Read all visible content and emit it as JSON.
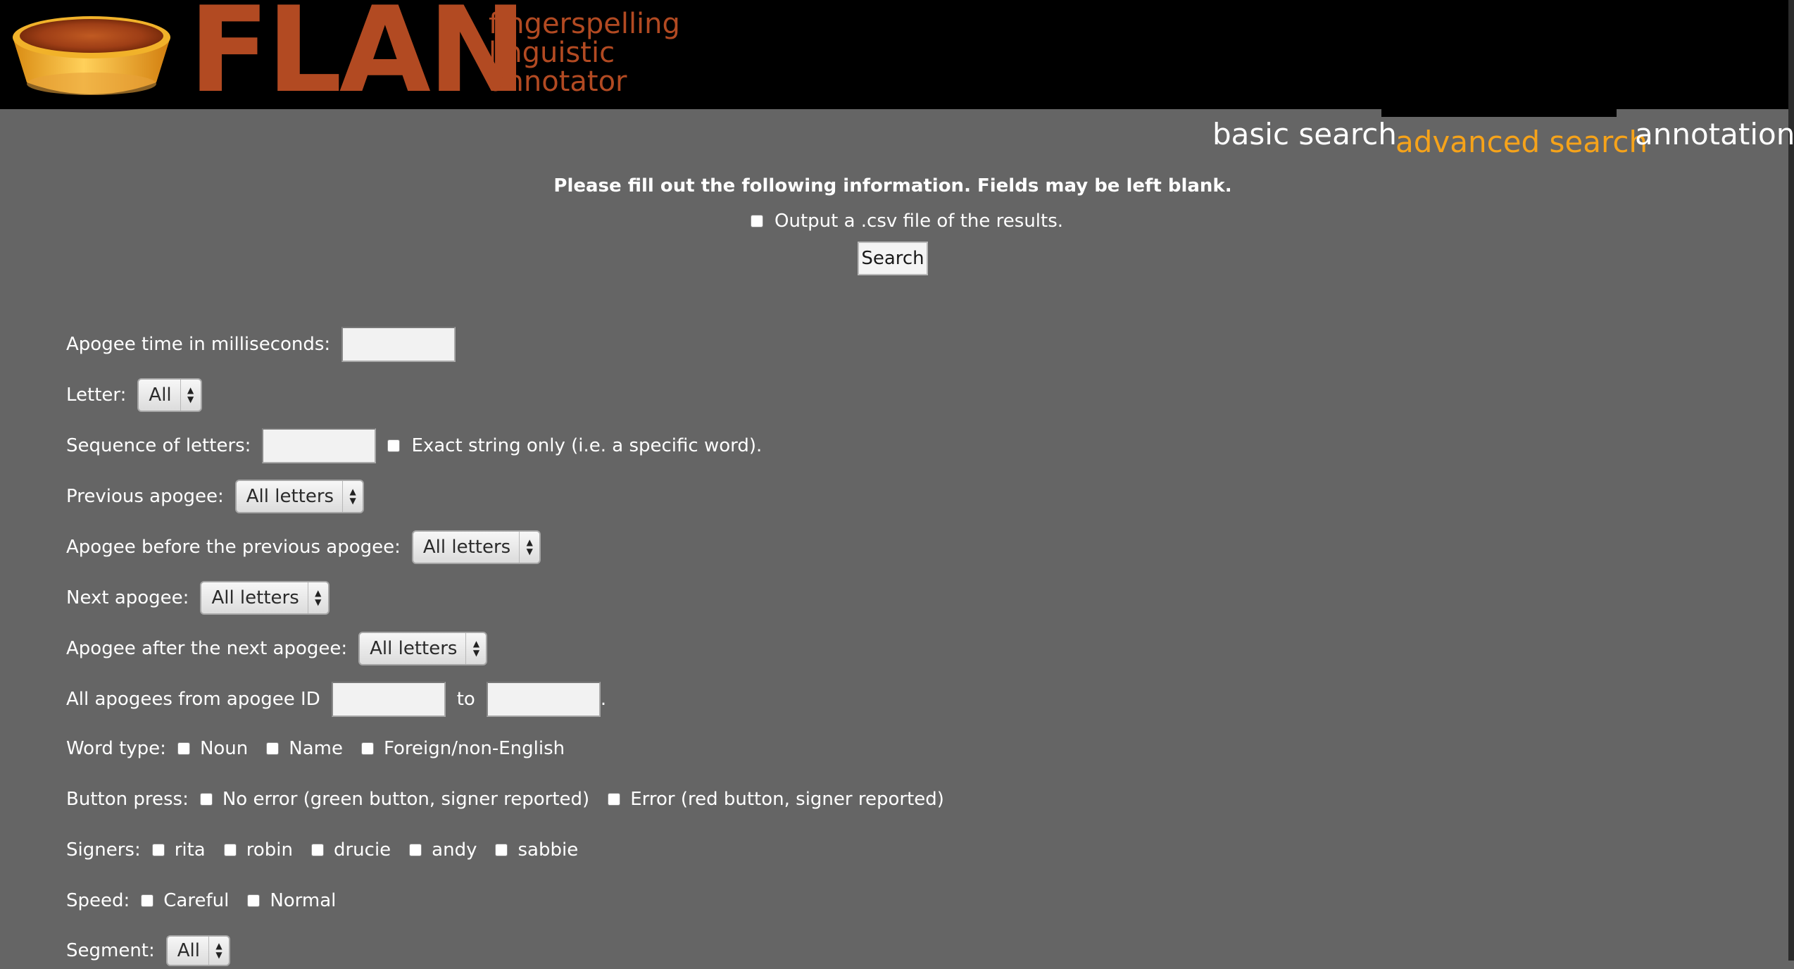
{
  "header": {
    "logo_text": "FLAN",
    "tagline_lines": [
      "fingerspelling",
      "linguistic",
      "annotator"
    ],
    "logo_colors": {
      "brand": "#b24a22",
      "bowl": "#f6a31a"
    }
  },
  "nav": {
    "tabs": [
      {
        "label": "basic search",
        "active": false
      },
      {
        "label": "advanced search",
        "active": true
      },
      {
        "label": "annotation",
        "active": false
      }
    ],
    "active_color": "#f6a31a"
  },
  "form": {
    "notice": "Please fill out the following information. Fields may be left blank.",
    "csv_label": "Output a .csv file of the results.",
    "search_button": "Search",
    "apogee_time": {
      "label": "Apogee time in milliseconds:",
      "value": ""
    },
    "letter": {
      "label": "Letter:",
      "selected": "All"
    },
    "sequence": {
      "label": "Sequence of letters:",
      "value": "",
      "exact_label": "Exact string only (i.e. a specific word)."
    },
    "previous_apogee": {
      "label": "Previous apogee:",
      "selected": "All letters"
    },
    "apogee_before_previous": {
      "label": "Apogee before the previous apogee:",
      "selected": "All letters"
    },
    "next_apogee": {
      "label": "Next apogee:",
      "selected": "All letters"
    },
    "apogee_after_next": {
      "label": "Apogee after the next apogee:",
      "selected": "All letters"
    },
    "apogee_range": {
      "label": "All apogees from apogee ID",
      "to_label": "to",
      "end_punct": ".",
      "from_value": "",
      "to_value": ""
    },
    "word_type": {
      "label": "Word type:",
      "options": [
        "Noun",
        "Name",
        "Foreign/non-English"
      ]
    },
    "button_press": {
      "label": "Button press:",
      "options": [
        "No error (green button, signer reported)",
        "Error (red button, signer reported)"
      ]
    },
    "signers": {
      "label": "Signers:",
      "options": [
        "rita",
        "robin",
        "drucie",
        "andy",
        "sabbie"
      ]
    },
    "speed": {
      "label": "Speed:",
      "options": [
        "Careful",
        "Normal"
      ]
    },
    "segment": {
      "label": "Segment:",
      "selected": "All"
    }
  }
}
